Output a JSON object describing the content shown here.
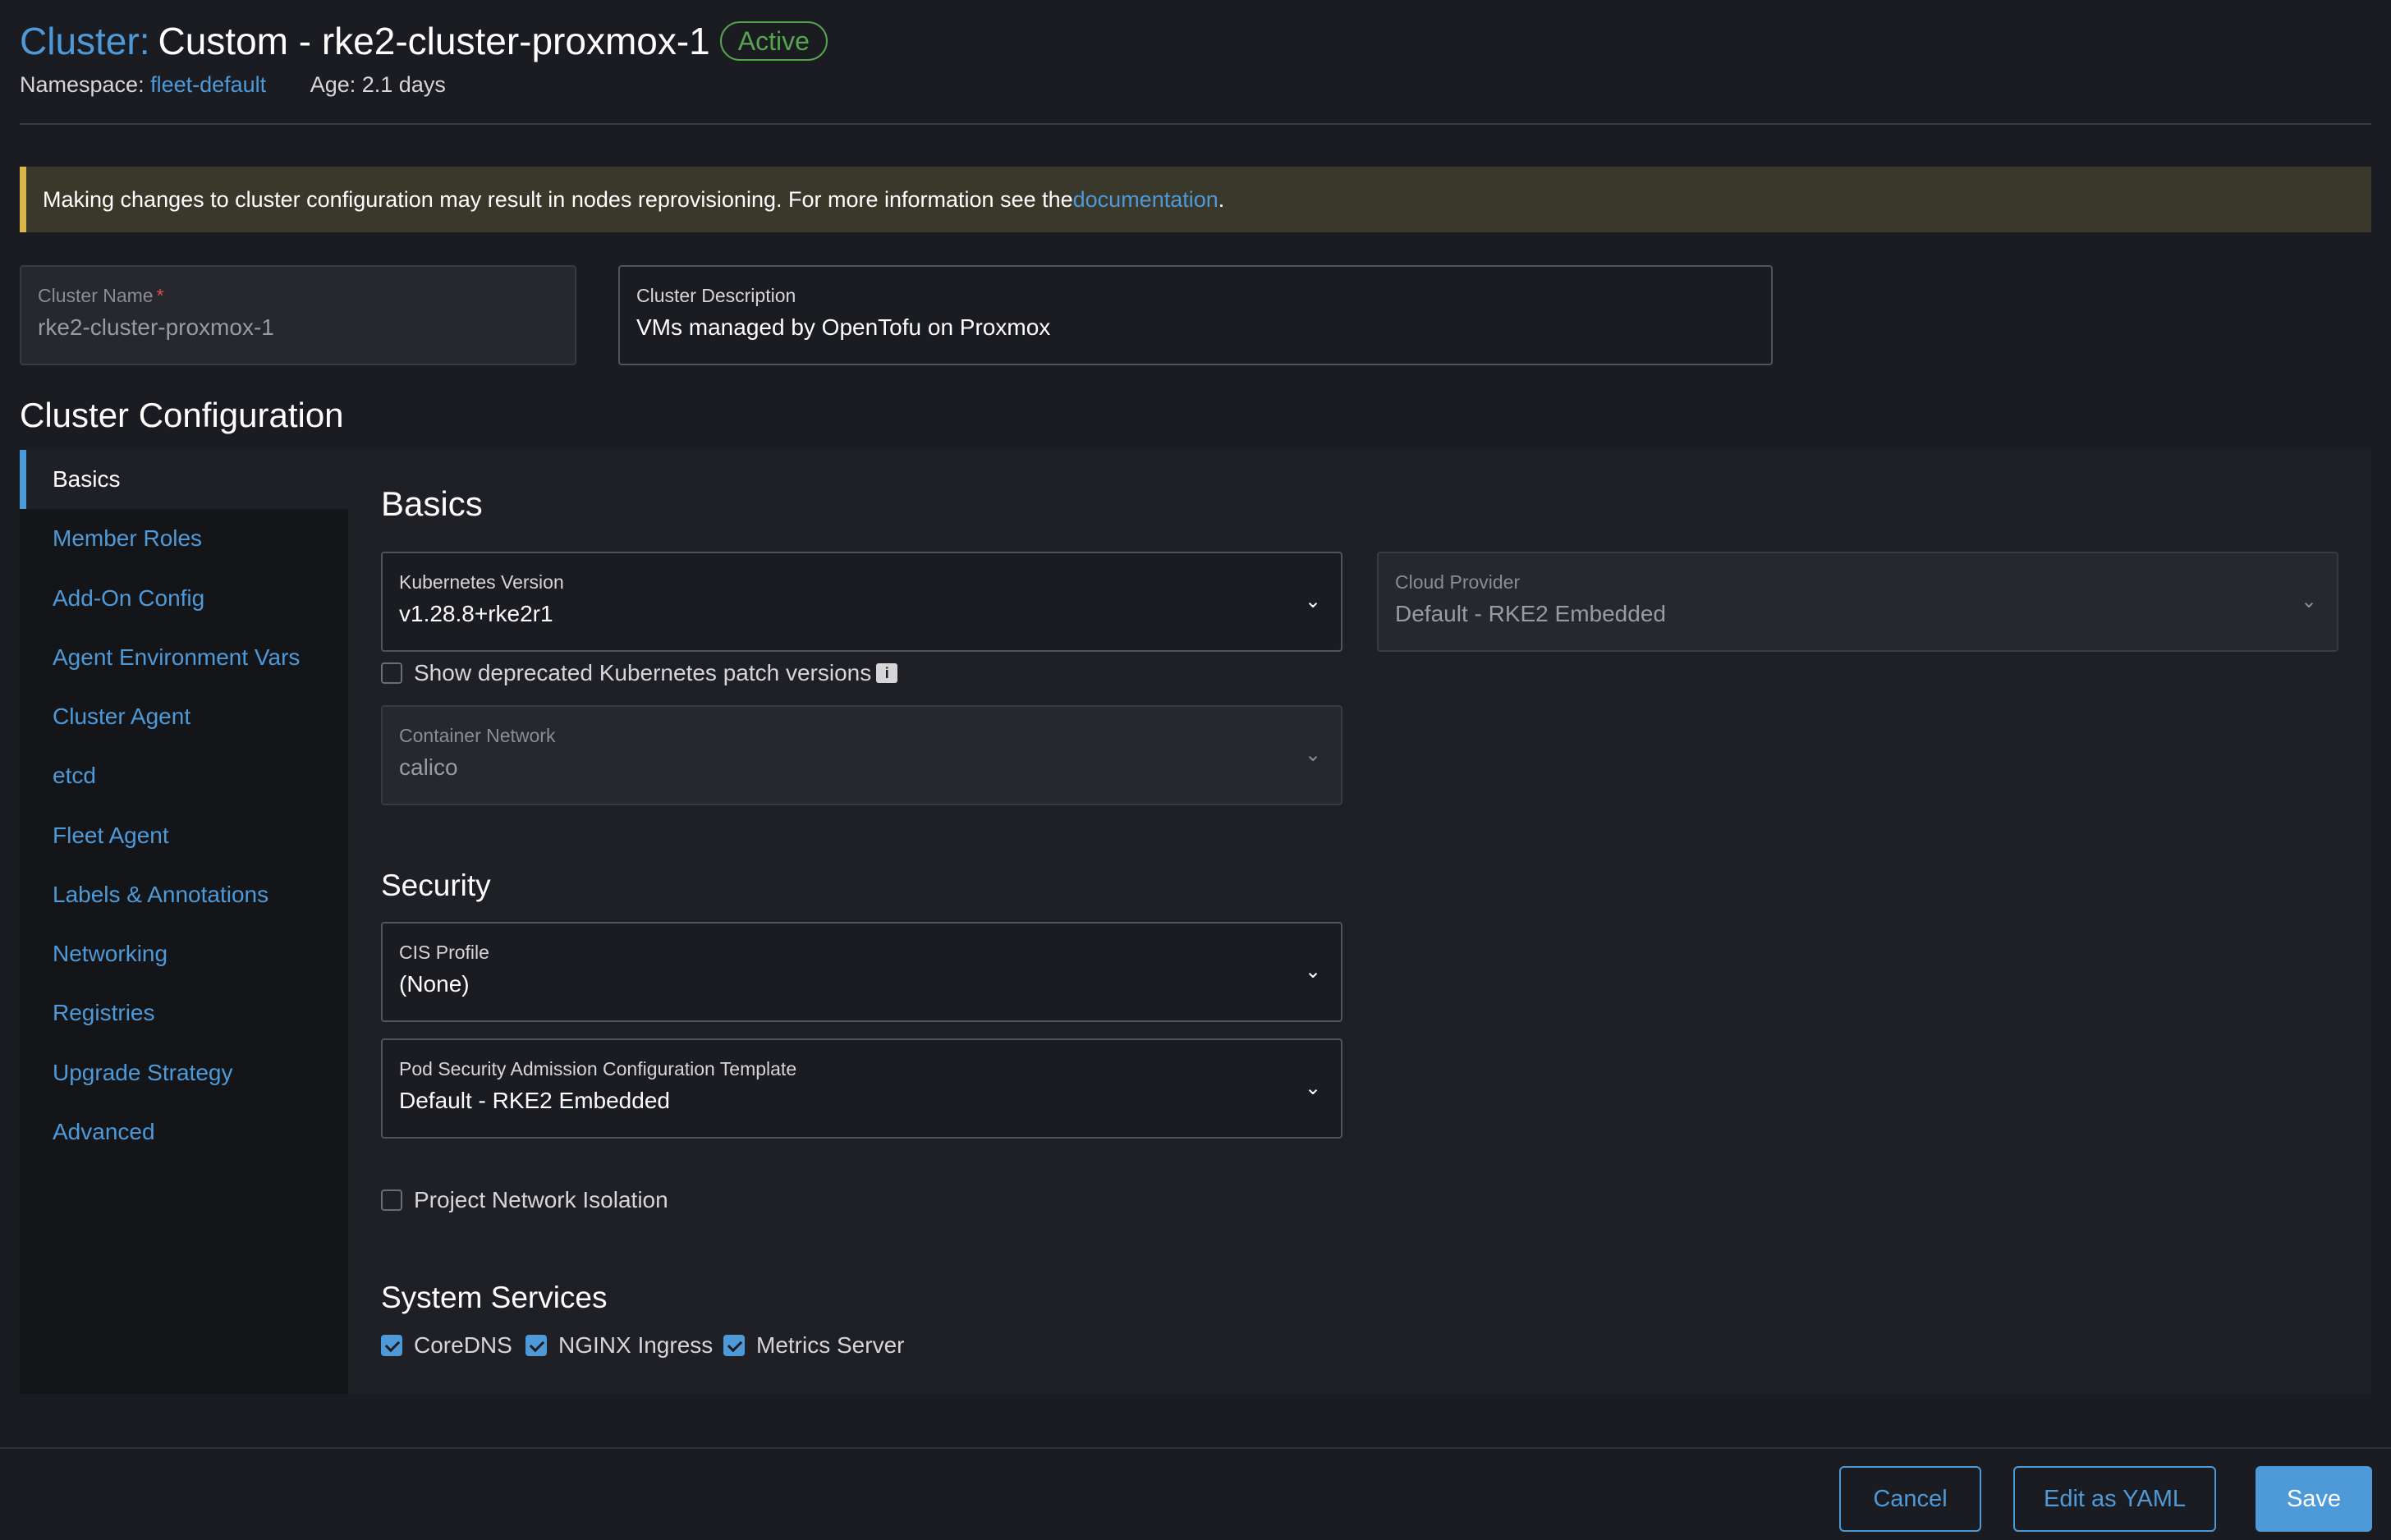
{
  "header": {
    "kind": "Cluster:",
    "title": "Custom - rke2-cluster-proxmox-1",
    "status": "Active",
    "namespace_label": "Namespace:",
    "namespace_value": "fleet-default",
    "age": "Age: 2.1 days"
  },
  "banner": {
    "text": "Making changes to cluster configuration may result in nodes reprovisioning. For more information see the ",
    "link": "documentation",
    "suffix": "."
  },
  "cluster_name": {
    "label": "Cluster Name",
    "required_mark": "*",
    "value": "rke2-cluster-proxmox-1"
  },
  "cluster_description": {
    "label": "Cluster Description",
    "value": "VMs managed by OpenTofu on Proxmox"
  },
  "config_title": "Cluster Configuration",
  "sidenav": {
    "items": [
      {
        "label": "Basics",
        "active": true
      },
      {
        "label": "Member Roles"
      },
      {
        "label": "Add-On Config"
      },
      {
        "label": "Agent Environment Vars"
      },
      {
        "label": "Cluster Agent"
      },
      {
        "label": "etcd"
      },
      {
        "label": "Fleet Agent"
      },
      {
        "label": "Labels & Annotations"
      },
      {
        "label": "Networking"
      },
      {
        "label": "Registries"
      },
      {
        "label": "Upgrade Strategy"
      },
      {
        "label": "Advanced"
      }
    ]
  },
  "basics": {
    "title": "Basics",
    "k8s_version": {
      "label": "Kubernetes Version",
      "value": "v1.28.8+rke2r1"
    },
    "cloud_provider": {
      "label": "Cloud Provider",
      "value": "Default - RKE2 Embedded"
    },
    "show_deprecated": {
      "label": "Show deprecated Kubernetes patch versions",
      "checked": false,
      "icon": "info-icon"
    },
    "container_network": {
      "label": "Container Network",
      "value": "calico"
    }
  },
  "security": {
    "title": "Security",
    "cis_profile": {
      "label": "CIS Profile",
      "value": "(None)"
    },
    "psa_template": {
      "label": "Pod Security Admission Configuration Template",
      "value": "Default - RKE2 Embedded"
    },
    "project_network_isolation": {
      "label": "Project Network Isolation",
      "checked": false
    }
  },
  "system_services": {
    "title": "System Services",
    "items": [
      {
        "label": "CoreDNS",
        "checked": true
      },
      {
        "label": "NGINX Ingress",
        "checked": true
      },
      {
        "label": "Metrics Server",
        "checked": true
      }
    ]
  },
  "footer": {
    "cancel": "Cancel",
    "edit_yaml": "Edit as YAML",
    "save": "Save"
  },
  "colors": {
    "accent": "#4e9ad8",
    "active_badge": "#56a44f",
    "warning_border": "#d8b74a",
    "required": "#e24c4c"
  }
}
